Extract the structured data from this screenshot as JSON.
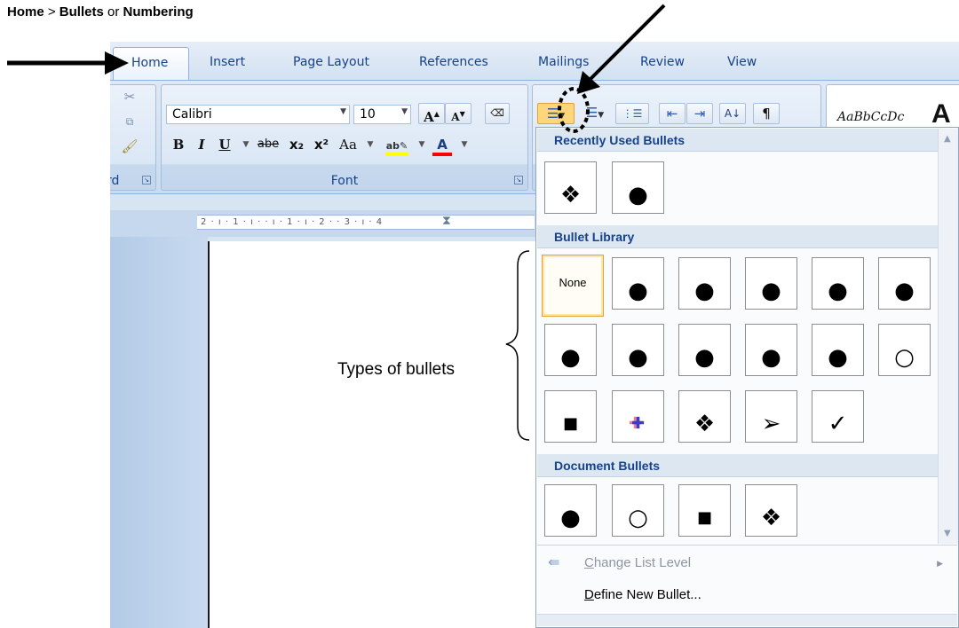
{
  "caption": {
    "part1": "Home",
    "sep": " > ",
    "part2": "Bullets",
    "or": " or ",
    "part3": "Numbering"
  },
  "tabs": [
    "Home",
    "Insert",
    "Page Layout",
    "References",
    "Mailings",
    "Review",
    "View"
  ],
  "clipboard": {
    "label": "rd"
  },
  "font_group": {
    "font_name": "Calibri",
    "font_size": "10",
    "label": "Font",
    "bold": "B",
    "italic": "I",
    "underline": "U",
    "strike": "abe",
    "subscript": "x₂",
    "superscript": "x²",
    "change_case": "Aa",
    "grow": "A",
    "shrink": "A"
  },
  "styles_preview": {
    "sample": "AaBbCcDc",
    "big": "A"
  },
  "ruler_text": "2 · ı · 1 · ı ·   · ı · 1 · ı · 2 ·   · 3 · ı · 4",
  "menu": {
    "sections": [
      "Recently Used Bullets",
      "Bullet Library",
      "Document Bullets"
    ],
    "recent": [
      "❖",
      "●"
    ],
    "library_row1": [
      "None",
      "●",
      "●",
      "●",
      "●",
      "●"
    ],
    "library_row2": [
      "●",
      "●",
      "●",
      "●",
      "●",
      "○"
    ],
    "library_row3": [
      "■",
      "✚",
      "❖",
      "➢",
      "✓"
    ],
    "document": [
      "●",
      "○",
      "■",
      "❖"
    ],
    "change_list_level": {
      "first": "C",
      "rest": "hange List Level"
    },
    "define_new": {
      "first": "D",
      "rest": "efine New Bullet..."
    }
  },
  "annotation": "Types of bullets",
  "colors": {
    "highlight": "#ffff00",
    "font_color": "#ff0000",
    "accent": "#15428b",
    "selected_border": "#e3a334"
  }
}
